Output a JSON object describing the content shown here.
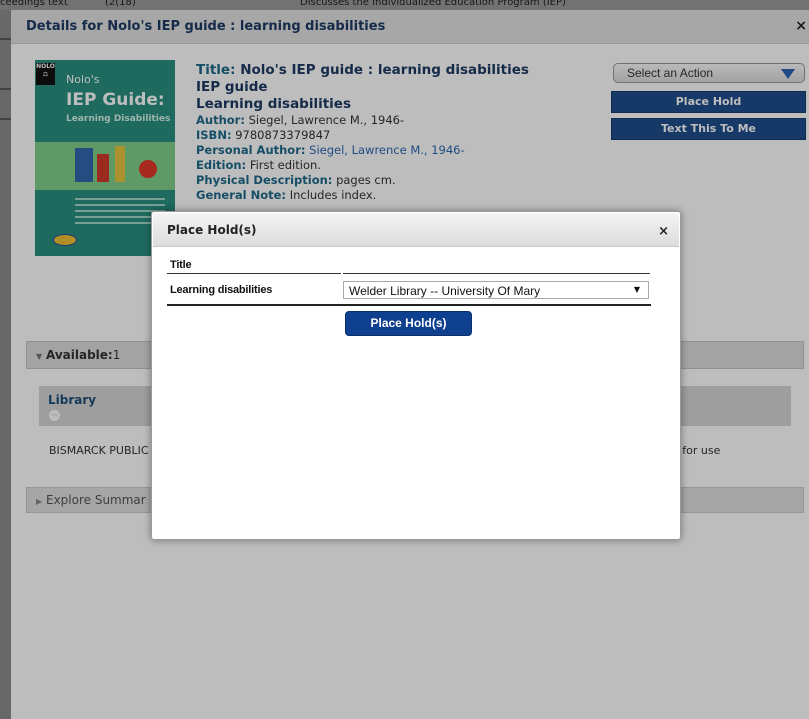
{
  "background_strip": {
    "left_text": "ceedings text",
    "mid_text": "(2(18)",
    "right_text": "Discusses the Individualized Education Program (IEP)"
  },
  "details": {
    "title": "Details for Nolo's IEP guide : learning disabilities",
    "close": "×",
    "cover": {
      "publisher": "NOLO",
      "line1": "Nolo's",
      "line2": "IEP Guide:",
      "line3": "Learning Disabilities"
    },
    "meta": {
      "title_label": "Title:",
      "title_value": "Nolo's IEP guide : learning disabilities",
      "line2": "IEP guide",
      "line3": "Learning disabilities",
      "author_label": "Author:",
      "author_value": "Siegel, Lawrence M., 1946-",
      "isbn_label": "ISBN:",
      "isbn_value": "9780873379847",
      "personal_label": "Personal Author:",
      "personal_value": "Siegel, Lawrence M., 1946-",
      "edition_label": "Edition:",
      "edition_value": "First edition.",
      "physical_label": "Physical Description:",
      "physical_value": "pages cm.",
      "general_label": "General Note:",
      "general_value": "Includes index."
    },
    "actions": {
      "select_label": "Select an Action",
      "place_hold": "Place Hold",
      "text_me": "Text This To Me"
    },
    "available": {
      "label": "Available:",
      "count": "1"
    },
    "library_header": "Library",
    "library_row": {
      "name": "BISMARCK PUBLIC",
      "status": "ble for use"
    },
    "explore": "Explore Summar"
  },
  "modal": {
    "title": "Place Hold(s)",
    "close": "×",
    "col_title": "Title",
    "item_title": "Learning disabilities",
    "pickup_selected": "Welder Library -- University Of Mary",
    "submit": "Place Hold(s)"
  }
}
